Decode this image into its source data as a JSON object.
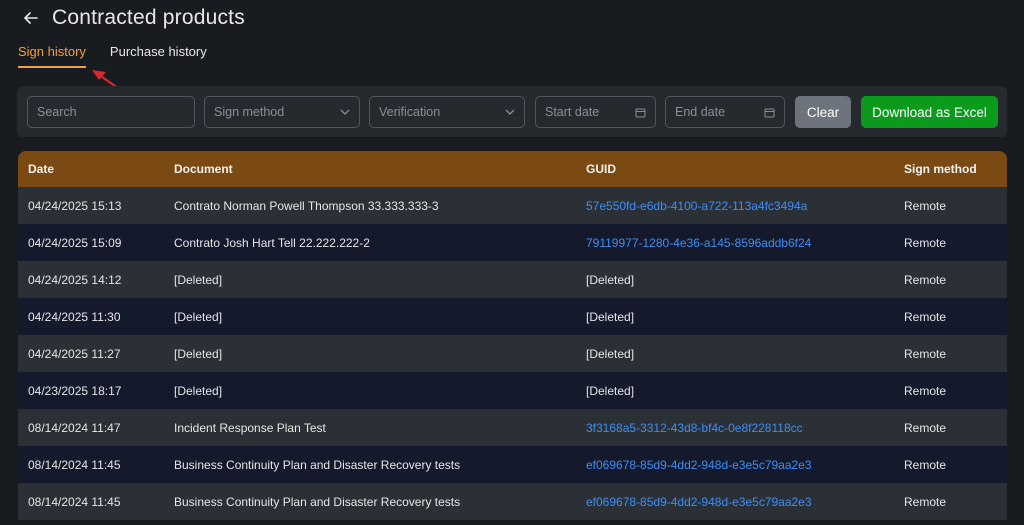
{
  "header": {
    "title": "Contracted products",
    "back_icon": "arrow-left-icon"
  },
  "tabs": [
    {
      "label": "Sign history",
      "active": true
    },
    {
      "label": "Purchase history",
      "active": false
    }
  ],
  "filters": {
    "search_placeholder": "Search",
    "sign_method_placeholder": "Sign method",
    "verification_placeholder": "Verification",
    "start_date_placeholder": "Start date",
    "end_date_placeholder": "End date",
    "clear_label": "Clear",
    "download_label": "Download as Excel"
  },
  "colors": {
    "accent": "#f5a13a",
    "table_header": "#7a4a12",
    "download_button": "#0a9a1c",
    "clear_button": "#6c737c",
    "link": "#3d8ef7",
    "annotation_arrow": "#d42a2a"
  },
  "table": {
    "columns": [
      "Date",
      "Document",
      "GUID",
      "Sign method"
    ],
    "rows": [
      {
        "date": "04/24/2025 15:13",
        "document": "Contrato Norman Powell Thompson 33.333.333-3",
        "guid": "57e550fd-e6db-4100-a722-113a4fc3494a",
        "guid_is_link": true,
        "sign_method": "Remote"
      },
      {
        "date": "04/24/2025 15:09",
        "document": "Contrato Josh Hart Tell 22.222.222-2",
        "guid": "79119977-1280-4e36-a145-8596addb6f24",
        "guid_is_link": true,
        "sign_method": "Remote"
      },
      {
        "date": "04/24/2025 14:12",
        "document": "[Deleted]",
        "guid": "[Deleted]",
        "guid_is_link": false,
        "sign_method": "Remote"
      },
      {
        "date": "04/24/2025 11:30",
        "document": "[Deleted]",
        "guid": "[Deleted]",
        "guid_is_link": false,
        "sign_method": "Remote"
      },
      {
        "date": "04/24/2025 11:27",
        "document": "[Deleted]",
        "guid": "[Deleted]",
        "guid_is_link": false,
        "sign_method": "Remote"
      },
      {
        "date": "04/23/2025 18:17",
        "document": "[Deleted]",
        "guid": "[Deleted]",
        "guid_is_link": false,
        "sign_method": "Remote"
      },
      {
        "date": "08/14/2024 11:47",
        "document": "Incident Response Plan Test",
        "guid": "3f3168a5-3312-43d8-bf4c-0e8f228118cc",
        "guid_is_link": true,
        "sign_method": "Remote"
      },
      {
        "date": "08/14/2024 11:45",
        "document": "Business Continuity Plan and Disaster Recovery tests",
        "guid": "ef069678-85d9-4dd2-948d-e3e5c79aa2e3",
        "guid_is_link": true,
        "sign_method": "Remote"
      },
      {
        "date": "08/14/2024 11:45",
        "document": "Business Continuity Plan and Disaster Recovery tests",
        "guid": "ef069678-85d9-4dd2-948d-e3e5c79aa2e3",
        "guid_is_link": true,
        "sign_method": "Remote"
      }
    ]
  }
}
